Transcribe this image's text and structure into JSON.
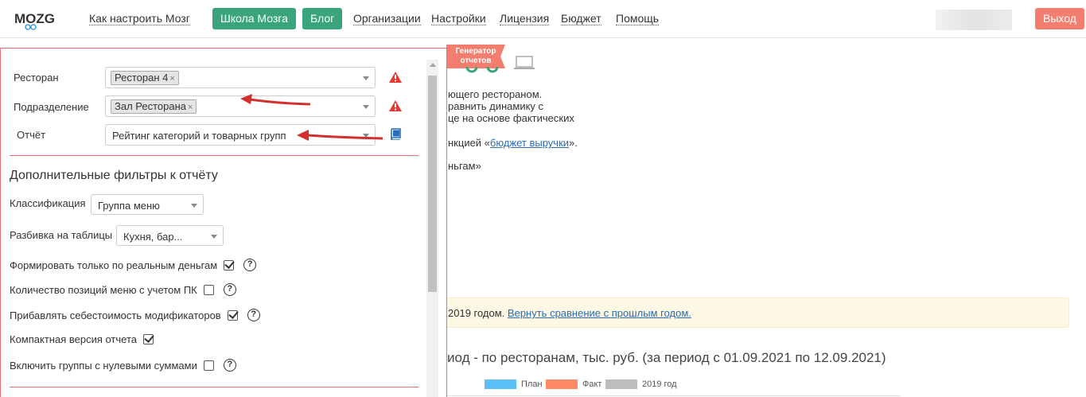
{
  "header": {
    "logo_text": "MOZG",
    "nav_links": [
      {
        "label": "Как настроить Мозг"
      },
      {
        "label": "Организации"
      },
      {
        "label": "Настройки"
      },
      {
        "label": "Лицензия"
      },
      {
        "label": "Бюджет"
      },
      {
        "label": "Помощь"
      }
    ],
    "nav_buttons": [
      {
        "label": "Школа Мозга"
      },
      {
        "label": "Блог"
      }
    ],
    "logout_label": "Выход"
  },
  "background": {
    "ribbon_label": "Генератор отчетов",
    "lines": [
      "ющего рестораном.",
      "равнить динамику с",
      "це на основе фактических",
      "нкцией «",
      "бюджет выручки",
      "».",
      "ньгам»"
    ],
    "alert_text": "2019 годом.",
    "alert_link": "Вернуть сравнение с прошлым годом.",
    "chart_title": "иод - по ресторанам, тыс. руб. (за период с 01.09.2021 по 12.09.2021)",
    "legend": [
      {
        "label": "План",
        "color": "#5bc0f8"
      },
      {
        "label": "Факт",
        "color": "#ff8a65"
      },
      {
        "label": "2019 год",
        "color": "#bdbdbd"
      }
    ]
  },
  "filters": {
    "restaurant": {
      "label": "Ресторан",
      "tag": "Ресторан 4",
      "remove": "×"
    },
    "division": {
      "label": "Подразделение",
      "tag": "Зал Ресторана",
      "remove": "×"
    },
    "report": {
      "label": "Отчёт",
      "value": "Рейтинг категорий и товарных групп"
    },
    "extra_title": "Дополнительные фильтры к отчёту",
    "classification": {
      "label": "Классификация",
      "value": "Группа меню"
    },
    "split": {
      "label": "Разбивка на таблицы",
      "value": "Кухня, бар..."
    },
    "options": [
      {
        "label": "Формировать только по реальным деньгам",
        "checked": true,
        "help": "?"
      },
      {
        "label": "Количество позиций меню с учетом ПК",
        "checked": false,
        "help": "?"
      },
      {
        "label": "Прибавлять себестоимость модификаторов",
        "checked": true,
        "help": "?"
      },
      {
        "label": "Компактная версия отчета",
        "checked": true,
        "help": ""
      },
      {
        "label": "Включить группы с нулевыми суммами",
        "checked": false,
        "help": "?"
      }
    ]
  },
  "colors": {
    "accent_green": "#3aa57d",
    "logout_red": "#f37d6e",
    "panel_border": "#e57373",
    "warning": "#e53935"
  }
}
